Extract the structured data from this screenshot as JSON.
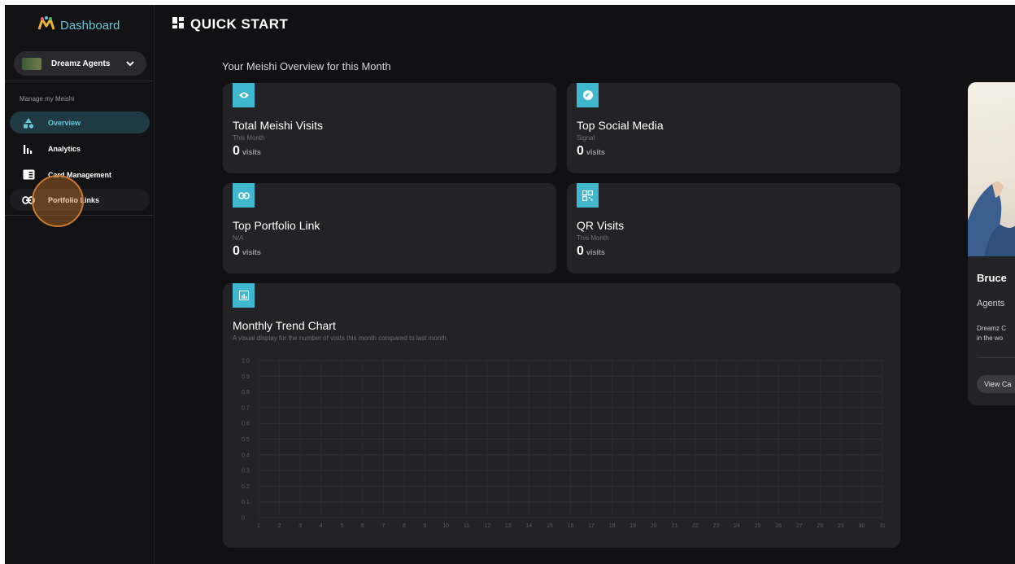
{
  "sidebar": {
    "brand": "Dashboard",
    "account": "Dreamz Agents",
    "section_label": "Manage my Meishi",
    "items": [
      {
        "label": "Overview",
        "icon": "shapes-icon"
      },
      {
        "label": "Analytics",
        "icon": "analytics-icon"
      },
      {
        "label": "Card Management",
        "icon": "card-icon"
      },
      {
        "label": "Portfolio Links",
        "icon": "link-icon"
      }
    ]
  },
  "header": {
    "title": "QUICK START"
  },
  "overview": {
    "title": "Your Meishi Overview for this Month",
    "cards": [
      {
        "title": "Total Meishi Visits",
        "sub": "This Month",
        "value": "0",
        "unit": "visits",
        "icon": "eye-icon"
      },
      {
        "title": "Top Social Media",
        "sub": "Signal",
        "value": "0",
        "unit": "visits",
        "icon": "signal-icon"
      },
      {
        "title": "Top Portfolio Link",
        "sub": "N/A",
        "value": "0",
        "unit": "visits",
        "icon": "link-icon"
      },
      {
        "title": "QR Visits",
        "sub": "This Month",
        "value": "0",
        "unit": "visits",
        "icon": "qr-icon"
      }
    ]
  },
  "chart": {
    "title": "Monthly Trend Chart",
    "subtitle": "A visual display for the number of visits this month compared to last month",
    "icon": "chart-icon"
  },
  "chart_data": {
    "type": "line",
    "x": [
      1,
      2,
      3,
      4,
      5,
      6,
      7,
      8,
      9,
      10,
      11,
      12,
      13,
      14,
      15,
      16,
      17,
      18,
      19,
      20,
      21,
      22,
      23,
      24,
      25,
      26,
      27,
      28,
      29,
      30,
      31
    ],
    "y_ticks": [
      "0",
      "0.1",
      "0.2",
      "0.3",
      "0.4",
      "0.5",
      "0.6",
      "0.7",
      "0.8",
      "0.9",
      "1.0"
    ],
    "ylim": [
      0,
      1
    ],
    "series": [],
    "grid": true
  },
  "profile": {
    "name": "Bruce",
    "company": "Agents",
    "desc_line1": "Dreamz C",
    "desc_line2": "in the wo",
    "button": "View Ca"
  },
  "colors": {
    "accent": "#3fb8cf",
    "accent_text": "#66c7d8",
    "card_bg": "#232326",
    "page_bg": "#111113",
    "click_ring": "#c97a2f"
  }
}
